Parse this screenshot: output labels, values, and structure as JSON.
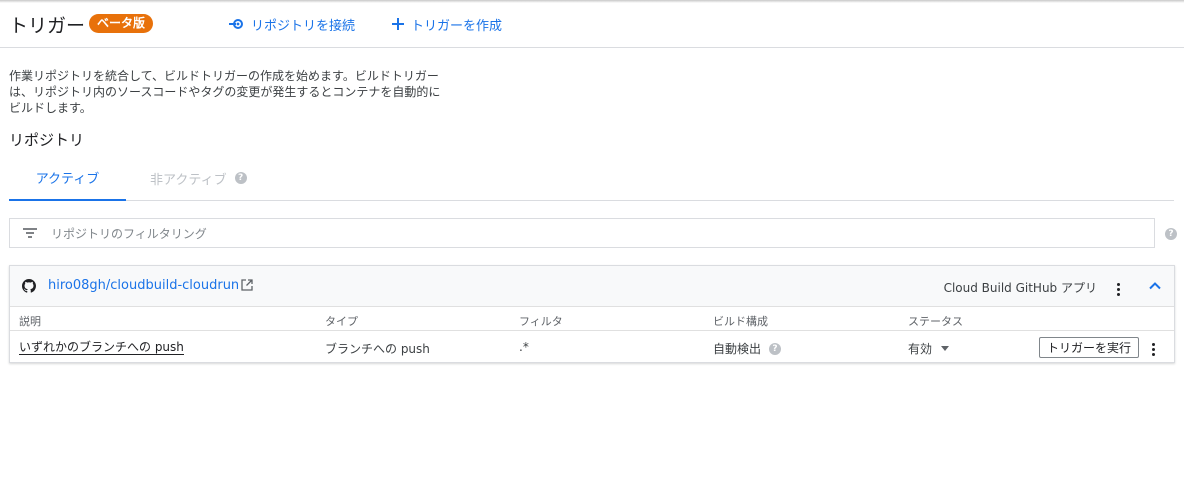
{
  "header": {
    "title": "トリガー",
    "badge": "ベータ版",
    "connect_label": "リポジトリを接続",
    "create_label": "トリガーを作成"
  },
  "intro": {
    "line1": "作業リポジトリを統合して、ビルドトリガーの作成を始めます。ビルドトリガー",
    "line2": "は、リポジトリ内のソースコードやタグの変更が発生するとコンテナを自動的に",
    "line3": "ビルドします。"
  },
  "section_title": "リポジトリ",
  "tabs": [
    {
      "label": "アクティブ",
      "active": true
    },
    {
      "label": "非アクティブ",
      "active": false
    }
  ],
  "filter": {
    "placeholder": "リポジトリのフィルタリング"
  },
  "repo": {
    "name": "hiro08gh/cloudbuild-cloudrun",
    "app_label": "Cloud Build GitHub アプリ",
    "columns": [
      "説明",
      "タイプ",
      "フィルタ",
      "ビルド構成",
      "ステータス"
    ],
    "rows": [
      {
        "description": "いずれかのブランチへの push",
        "type": "ブランチへの push",
        "filter": ".*",
        "build_config": "自動検出",
        "status": "有効",
        "run_label": "トリガーを実行"
      }
    ]
  },
  "icons": {
    "connect": "connect-repo-icon",
    "create": "add-icon",
    "filter": "filter-list-icon",
    "help": "help-icon",
    "github": "github-icon",
    "external": "open-in-new-icon",
    "more": "more-vert-icon",
    "collapse": "expand-less-icon"
  },
  "colors": {
    "accent": "#1a73e8",
    "badge": "#e8710a"
  }
}
